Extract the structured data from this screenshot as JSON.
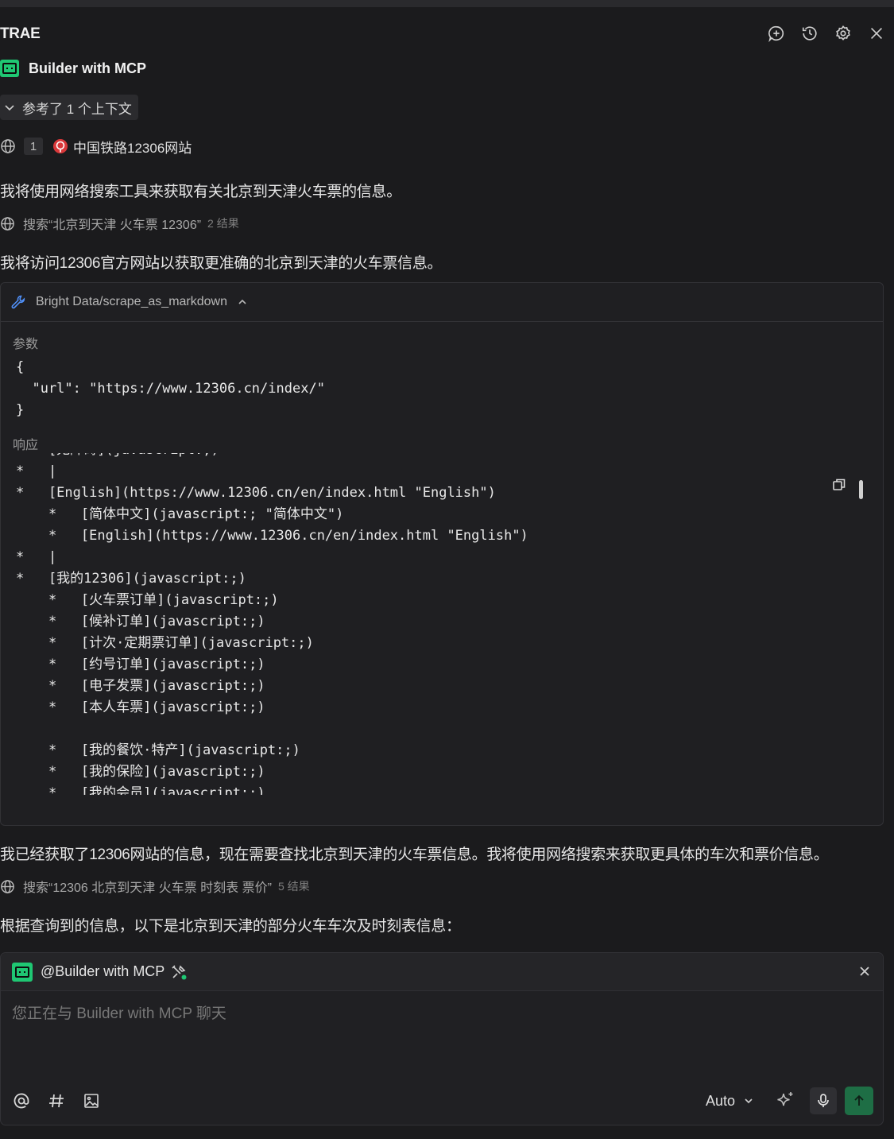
{
  "header": {
    "title": "TRAE",
    "icons": [
      "new-chat-icon",
      "history-icon",
      "settings-icon",
      "close-icon"
    ]
  },
  "agent": {
    "name": "Builder with MCP"
  },
  "context": {
    "toggle_label": "参考了 1 个上下文",
    "ref_count": "1",
    "ref_name": "中国铁路12306网站"
  },
  "messages": {
    "m1": "我将使用网络搜索工具来获取有关北京到天津火车票的信息。",
    "search1_query": "搜索“北京到天津 火车票 12306”",
    "search1_count": "2 结果",
    "m2": "我将访问12306官方网站以获取更准确的北京到天津的火车票信息。",
    "m3": "我已经获取了12306网站的信息，现在需要查找北京到天津的火车票信息。我将使用网络搜索来获取更具体的车次和票价信息。",
    "search2_query": "搜索“12306 北京到天津 火车票 时刻表 票价”",
    "search2_count": "5 结果",
    "m4": "根据查询到的信息，以下是北京到天津的部分火车车次及时刻表信息："
  },
  "tool_call": {
    "name": "Bright Data/scrape_as_markdown",
    "params_label": "参数",
    "params_code": "{\n  \"url\": \"https://www.12306.cn/index/\"\n}",
    "response_label": "响应",
    "response_code": "*   [无障碍](javascript:;)\n*   |\n*   [English](https://www.12306.cn/en/index.html \"English\")\n    *   [简体中文](javascript:; \"简体中文\")\n    *   [English](https://www.12306.cn/en/index.html \"English\")\n*   |\n*   [我的12306](javascript:;)\n    *   [火车票订单](javascript:;)\n    *   [候补订单](javascript:;)\n    *   [计次·定期票订单](javascript:;)\n    *   [约号订单](javascript:;)\n    *   [电子发票](javascript:;)\n    *   [本人车票](javascript:;)\n\n    *   [我的餐饮·特产](javascript:;)\n    *   [我的保险](javascript:;)\n    *   [我的会员](javascript:;)"
  },
  "chat": {
    "mention": "@Builder with MCP",
    "placeholder": "您正在与 Builder with MCP 聊天",
    "model": "Auto"
  },
  "colors": {
    "background": "#1b1b1d",
    "accent_green": "#1fc773",
    "send_button": "#1e6e45",
    "tool_icon": "#4f8ff7"
  }
}
